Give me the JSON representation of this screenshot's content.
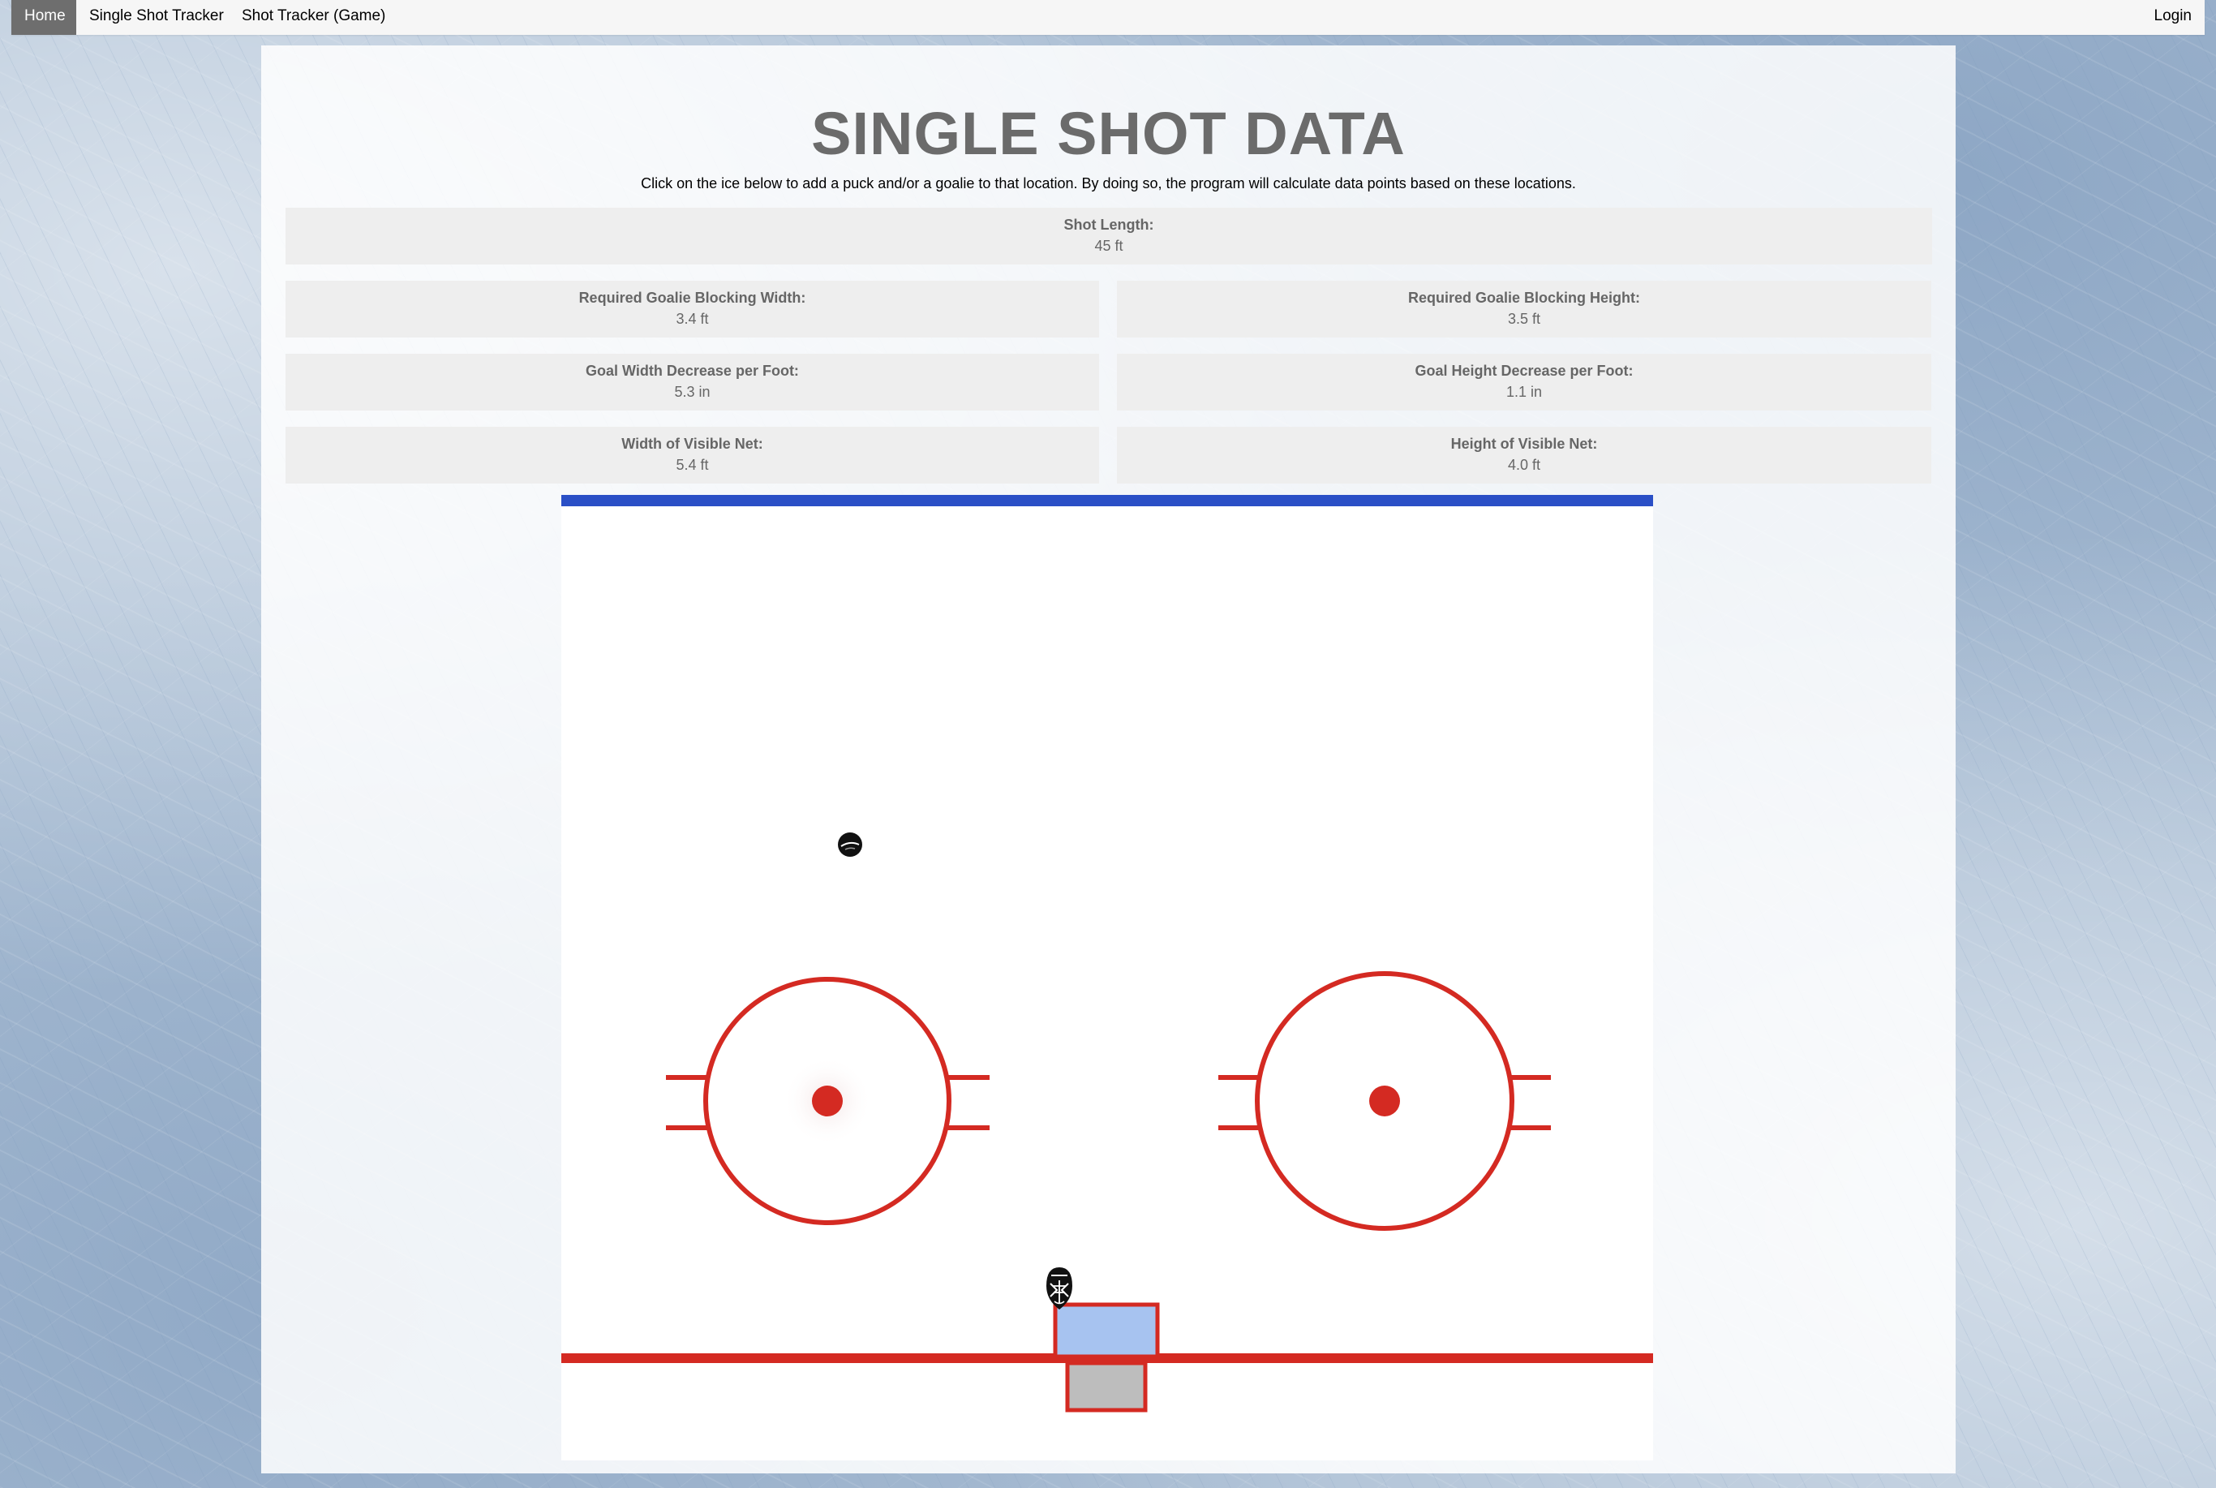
{
  "nav": {
    "home": "Home",
    "single_shot_tracker": "Single Shot Tracker",
    "shot_tracker_game": "Shot Tracker (Game)",
    "login": "Login"
  },
  "page": {
    "title": "SINGLE SHOT DATA",
    "instructions": "Click on the ice below to add a puck and/or a goalie to that location. By doing so, the program will calculate data points based on these locations."
  },
  "stats": {
    "shot_length": {
      "label": "Shot Length:",
      "value": "45 ft"
    },
    "req_width": {
      "label": "Required Goalie Blocking Width:",
      "value": "3.4 ft"
    },
    "req_height": {
      "label": "Required Goalie Blocking Height:",
      "value": "3.5 ft"
    },
    "width_decrease": {
      "label": "Goal Width Decrease per Foot:",
      "value": "5.3 in"
    },
    "height_decrease": {
      "label": "Goal Height Decrease per Foot:",
      "value": "1.1 in"
    },
    "visible_width": {
      "label": "Width of Visible Net:",
      "value": "5.4 ft"
    },
    "visible_height": {
      "label": "Height of Visible Net:",
      "value": "4.0 ft"
    }
  },
  "colors": {
    "blue_line": "#2a4fc6",
    "red_line": "#d42a22",
    "crease": "#a7c3f0",
    "net": "#bdbdbd",
    "puck": "#111111"
  },
  "icons": {
    "puck": "hockey-puck-icon",
    "goalie": "goalie-mask-icon"
  }
}
